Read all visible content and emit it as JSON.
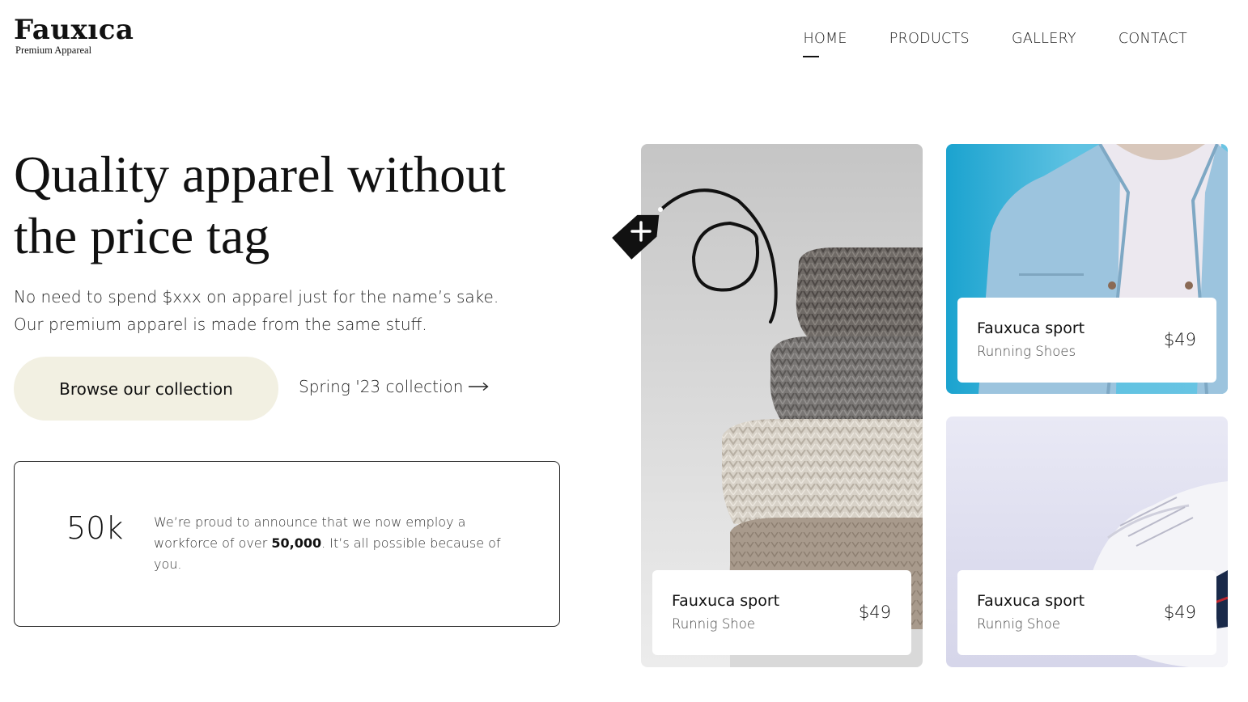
{
  "brand": {
    "name": "Fauxıca",
    "tagline": "Premium Appareal"
  },
  "nav": {
    "items": [
      {
        "label": "HOME",
        "active": true
      },
      {
        "label": "PRODUCTS",
        "active": false
      },
      {
        "label": "GALLERY",
        "active": false
      },
      {
        "label": "CONTACT",
        "active": false
      }
    ]
  },
  "hero": {
    "title": "Quality apparel without the price tag",
    "subtitle_line1": "No need to spend $xxx on apparel just for the name’s sake.",
    "subtitle_line2": "Our premium apparel is made from the same stuff.",
    "browse_label": "Browse our collection",
    "spring_label": "Spring '23 collection"
  },
  "stat": {
    "value": "50k",
    "text_before": "We’re proud to announce that we now employ a workforce of over ",
    "text_bold": "50,000",
    "text_after": ". It’s all possible because of you."
  },
  "products": [
    {
      "title": "Fauxuca sport",
      "subtitle": "Runnig Shoe",
      "price": "$49",
      "image": "folded-sweaters"
    },
    {
      "title": "Fauxuca sport",
      "subtitle": "Running Shoes",
      "price": "$49",
      "image": "denim-jacket"
    },
    {
      "title": "Fauxuca sport",
      "subtitle": "Runnig Shoe",
      "price": "$49",
      "image": "white-sneaker"
    }
  ],
  "icons": {
    "price_tag": "price-tag-icon",
    "arrow": "arrow-right-icon"
  },
  "colors": {
    "button_bg": "#f2f0e2",
    "text": "#111111",
    "jacket_bg": "#4fb8dc",
    "shoe_bg": "#e0e0f0"
  }
}
